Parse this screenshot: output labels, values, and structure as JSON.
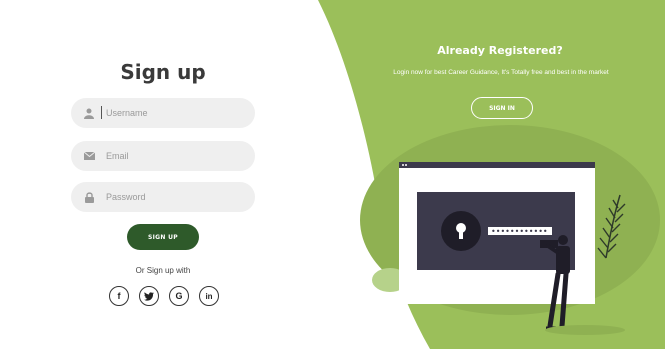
{
  "signup": {
    "title": "Sign up",
    "username_placeholder": "Username",
    "email_placeholder": "Email",
    "password_placeholder": "Password",
    "button_label": "SIGN UP",
    "or_text": "Or Sign up with",
    "social": [
      {
        "name": "facebook",
        "glyph": "f"
      },
      {
        "name": "twitter",
        "glyph": "y"
      },
      {
        "name": "google",
        "glyph": "G"
      },
      {
        "name": "linkedin",
        "glyph": "in"
      }
    ]
  },
  "panel": {
    "title": "Already Registered?",
    "subtitle": "Login now for best Career Guidance, It's Totally free and best in the market",
    "button_label": "SIGN IN",
    "password_dots": "••••••••••••"
  },
  "icons": {
    "username": "user-icon",
    "email": "envelope-icon",
    "password": "lock-icon"
  },
  "colors": {
    "panel_green": "#9bbf5a",
    "dark_green": "#2e5a2a",
    "field_bg": "#efefef",
    "illus_dark": "#3c3a4c"
  }
}
